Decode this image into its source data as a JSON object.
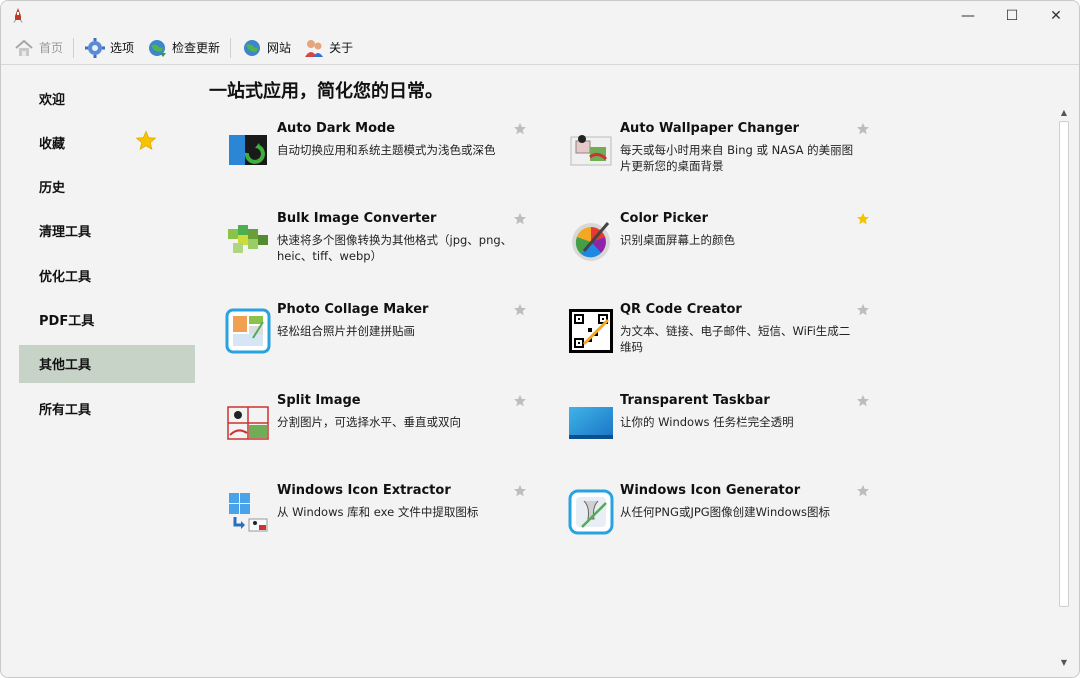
{
  "window": {
    "icons": {
      "app": "rocket-icon",
      "minimize": "minimize-icon",
      "maximize": "maximize-icon",
      "close": "close-icon"
    },
    "minimize_glyph": "—",
    "maximize_glyph": "☐",
    "close_glyph": "✕"
  },
  "toolbar": {
    "items": [
      {
        "label": "首页",
        "icon": "home-icon",
        "disabled": true
      },
      {
        "label": "选项",
        "icon": "gear-icon",
        "disabled": false
      },
      {
        "label": "检查更新",
        "icon": "globe-update-icon",
        "disabled": false
      },
      {
        "label": "网站",
        "icon": "globe-icon",
        "disabled": false
      },
      {
        "label": "关于",
        "icon": "users-icon",
        "disabled": false
      }
    ]
  },
  "sidebar": {
    "items": [
      {
        "label": "欢迎",
        "active": false
      },
      {
        "label": "收藏",
        "active": false,
        "icon": "star-icon"
      },
      {
        "label": "历史",
        "active": false
      },
      {
        "label": "清理工具",
        "active": false
      },
      {
        "label": "优化工具",
        "active": false
      },
      {
        "label": "PDF工具",
        "active": false
      },
      {
        "label": "其他工具",
        "active": true
      },
      {
        "label": "所有工具",
        "active": false
      }
    ]
  },
  "main": {
    "title": "一站式应用，简化您的日常。",
    "tools": [
      {
        "name": "Auto Dark Mode",
        "desc": "自动切换应用和系统主题模式为浅色或深色",
        "favorite": false,
        "icon": "dark-mode-icon"
      },
      {
        "name": "Auto Wallpaper Changer",
        "desc": "每天或每小时用来自 Bing 或 NASA 的美丽图片更新您的桌面背景",
        "favorite": false,
        "icon": "wallpaper-icon"
      },
      {
        "name": "Bulk Image Converter",
        "desc": "快速将多个图像转换为其他格式（jpg、png、heic、tiff、webp）",
        "favorite": false,
        "icon": "image-converter-icon"
      },
      {
        "name": "Color Picker",
        "desc": "识别桌面屏幕上的颜色",
        "favorite": true,
        "icon": "color-picker-icon"
      },
      {
        "name": "Photo Collage Maker",
        "desc": "轻松组合照片并创建拼贴画",
        "favorite": false,
        "icon": "collage-icon"
      },
      {
        "name": "QR Code Creator",
        "desc": "为文本、链接、电子邮件、短信、WiFi生成二维码",
        "favorite": false,
        "icon": "qr-code-icon"
      },
      {
        "name": "Split Image",
        "desc": "分割图片，可选择水平、垂直或双向",
        "favorite": false,
        "icon": "split-image-icon"
      },
      {
        "name": "Transparent Taskbar",
        "desc": "让你的 Windows 任务栏完全透明",
        "favorite": false,
        "icon": "taskbar-icon"
      },
      {
        "name": "Windows Icon Extractor",
        "desc": "从 Windows 库和 exe 文件中提取图标",
        "favorite": false,
        "icon": "icon-extractor-icon"
      },
      {
        "name": "Windows Icon Generator",
        "desc": "从任何PNG或JPG图像创建Windows图标",
        "favorite": false,
        "icon": "icon-generator-icon"
      }
    ]
  },
  "colors": {
    "active_nav": "#c8d3c8",
    "star_on": "#f5c400",
    "star_off": "#bdbdbd"
  }
}
